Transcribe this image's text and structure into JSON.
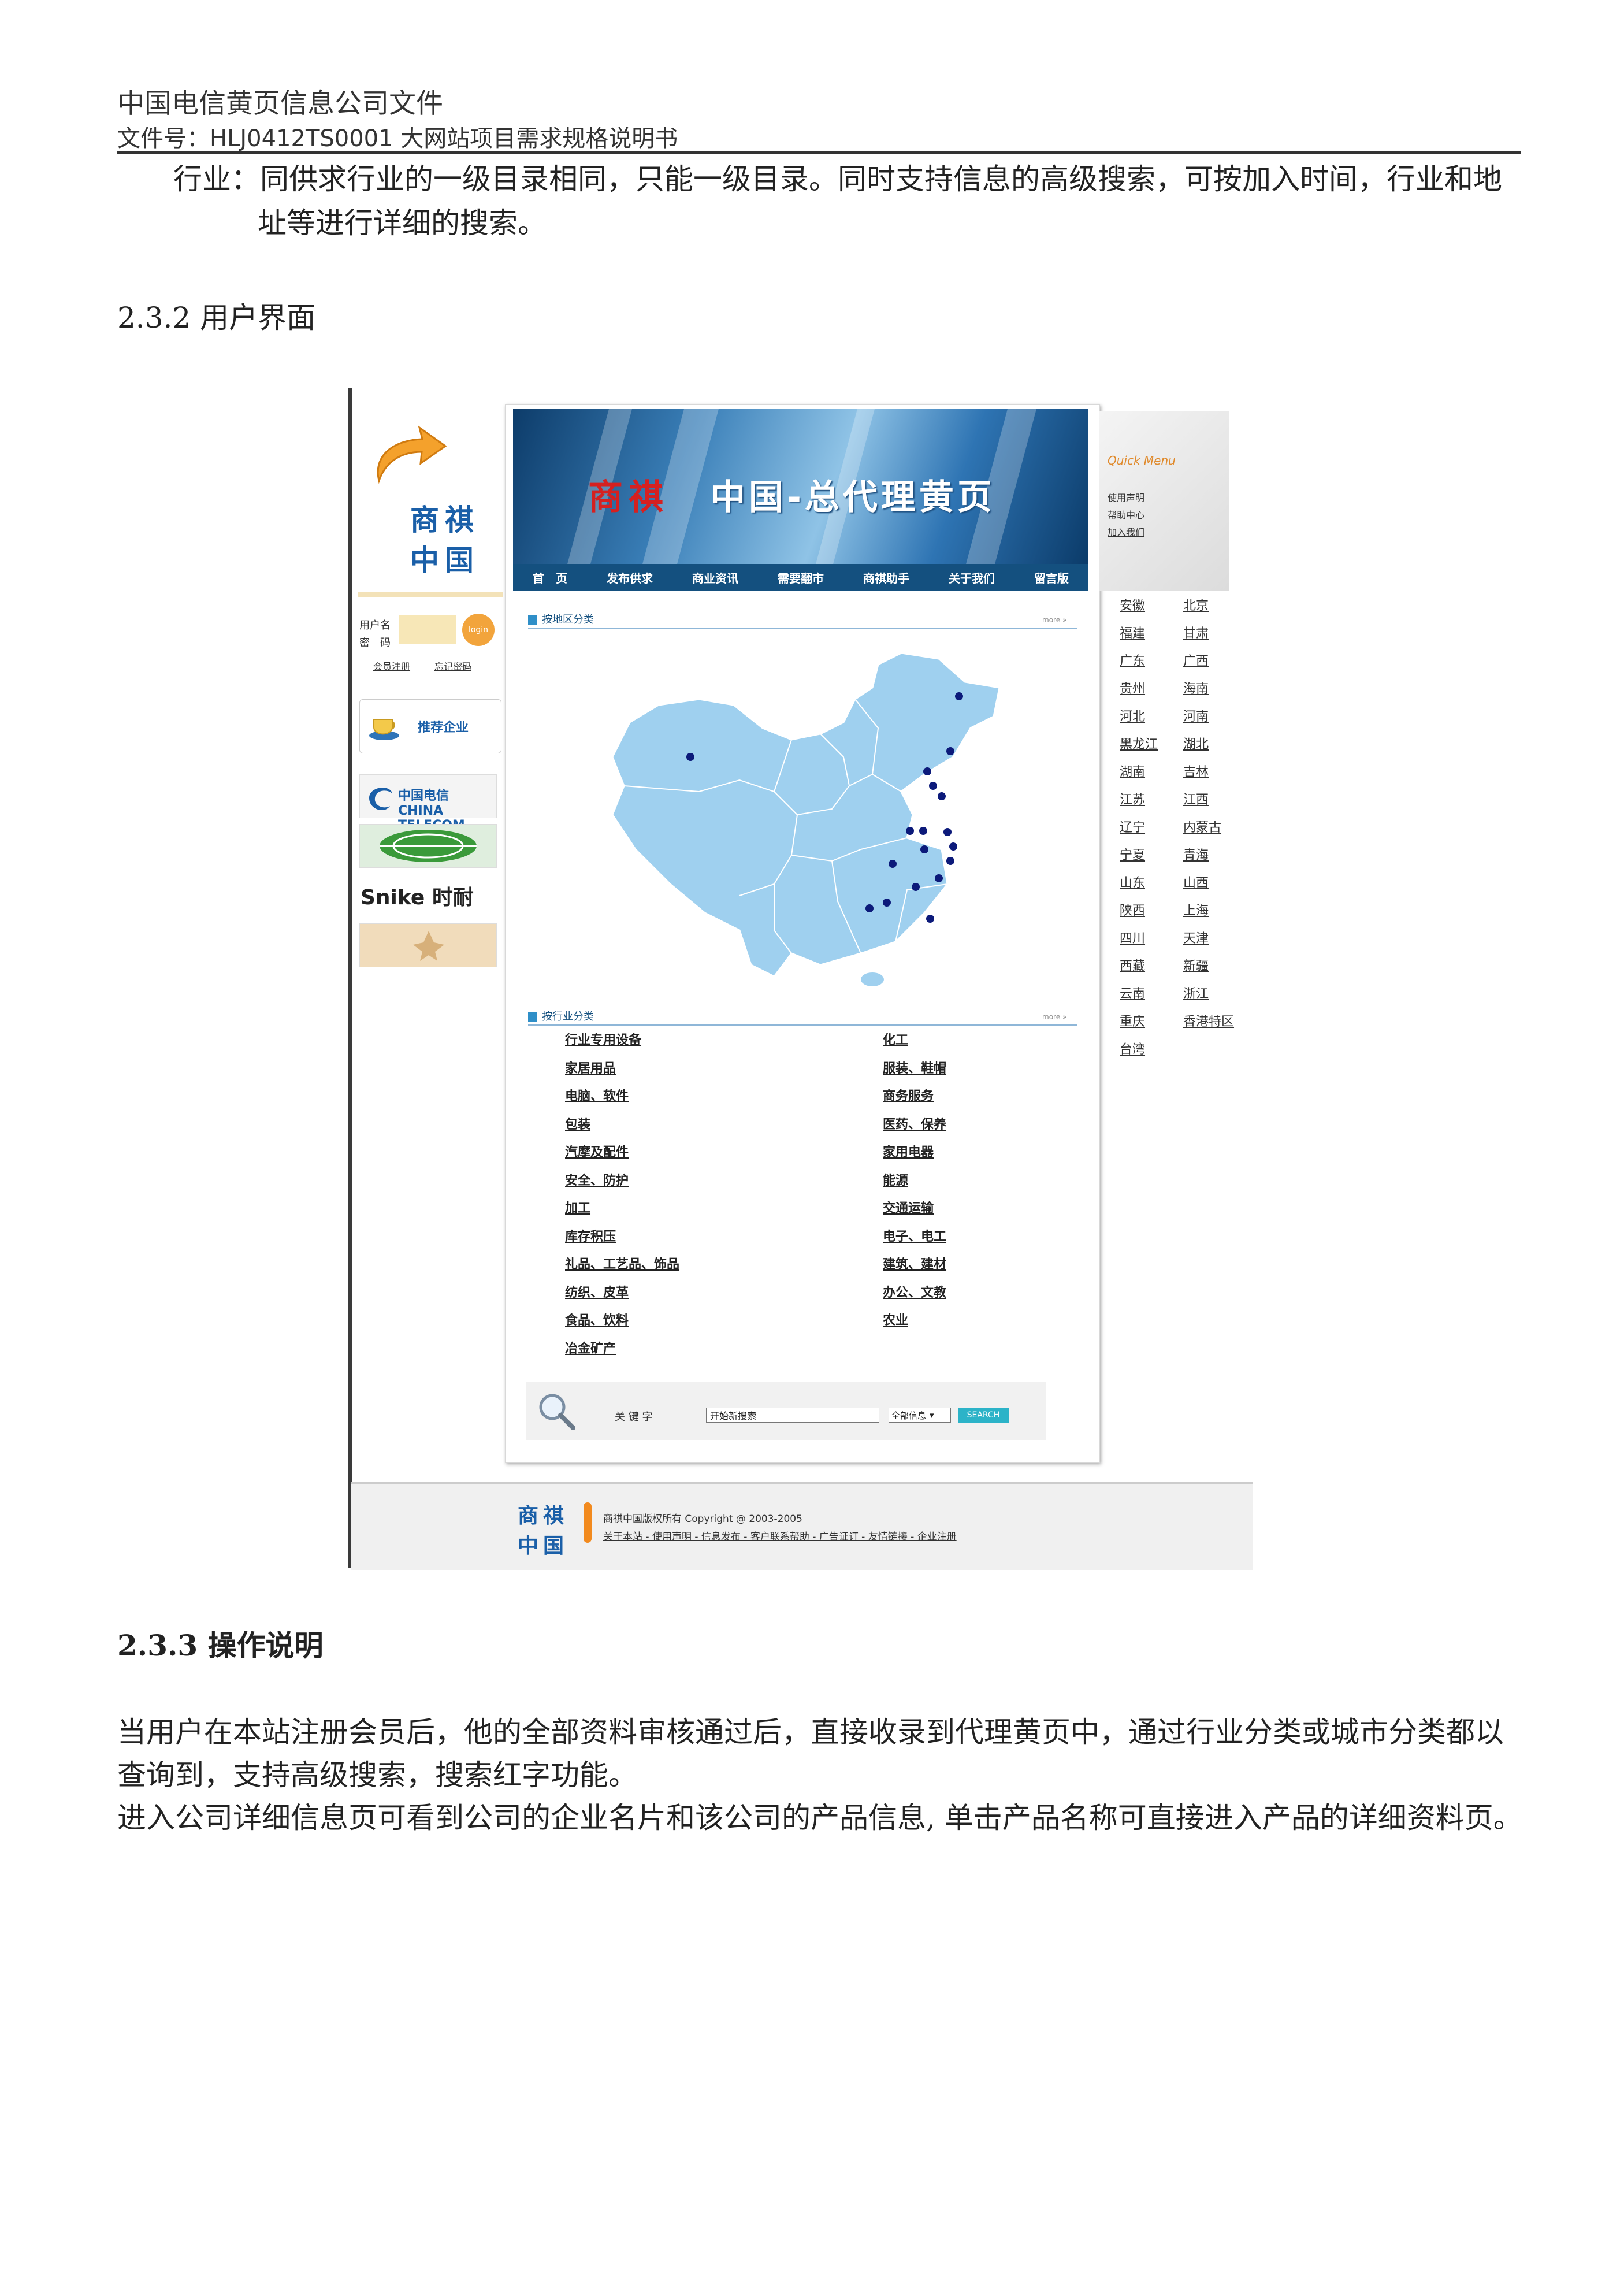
{
  "doc": {
    "header_title": "中国电信黄页信息公司文件",
    "header_docno": "文件号：HLJ0412TS0001  大网站项目需求规格说明书",
    "para1_line1": "行业：同供求行业的一级目录相同，只能一级目录。同时支持信息的高级搜索，可按加入时间，行业和地",
    "para1_line2": "址等进行详细的搜索。",
    "section_232": "2.3.2 用户界面",
    "section_233": "2.3.3 操作说明",
    "para2_line1": "当用户在本站注册会员后，他的全部资料审核通过后，直接收录到代理黄页中，通过行业分类或城市分类都以",
    "para2_line2": "查询到，支持高级搜索，搜索红字功能。",
    "para3_line1": "进入公司详细信息页可看到公司的企业名片和该公司的产品信息, 单击产品名称可直接进入产品的详细资料页。"
  },
  "site": {
    "logo_line1": "商祺",
    "logo_line2": "中国",
    "banner_brand": "商祺",
    "banner_slogan": "中国-总代理黄页",
    "nav": [
      "首　页",
      "发布供求",
      "商业资讯",
      "需要翻市",
      "商祺助手",
      "关于我们",
      "留言版"
    ],
    "quick_menu": {
      "title": "Quick Menu",
      "items": [
        "使用声明",
        "帮助中心",
        "加入我们"
      ]
    },
    "login": {
      "username_label": "用户名",
      "password_label": "密　码",
      "button": "login",
      "register_link": "会员注册",
      "forgot_link": "忘记密码"
    },
    "recommend_label": "推荐企业",
    "partners": [
      "中国电信 CHINA TELECOM",
      "",
      "Snike 时耐",
      ""
    ],
    "region_section_title": "按地区分类",
    "industry_section_title": "按行业分类",
    "more_label": "more »",
    "regions_col1": [
      "安徽",
      "福建",
      "广东",
      "贵州",
      "河北",
      "黑龙江",
      "湖南",
      "江苏",
      "辽宁",
      "宁夏",
      "山东",
      "陕西",
      "四川",
      "西藏",
      "云南",
      "重庆",
      "台湾"
    ],
    "regions_col2": [
      "北京",
      "甘肃",
      "广西",
      "海南",
      "河南",
      "湖北",
      "吉林",
      "江西",
      "内蒙古",
      "青海",
      "山西",
      "上海",
      "天津",
      "新疆",
      "浙江",
      "香港特区"
    ],
    "industries_col1": [
      "行业专用设备",
      "家居用品",
      "电脑、软件",
      "包装",
      "汽摩及配件",
      "安全、防护",
      "加工",
      "库存积压",
      "礼品、工艺品、饰品",
      "纺织、皮革",
      "食品、饮料",
      "冶金矿产"
    ],
    "industries_col2": [
      "化工",
      "服装、鞋帽",
      "商务服务",
      "医药、保养",
      "家用电器",
      "能源",
      "交通运输",
      "电子、电工",
      "建筑、建材",
      "办公、文教",
      "农业"
    ],
    "search": {
      "keyword_label": "关 键 字",
      "input_value": "开始新搜索",
      "select_value": "全部信息",
      "button": "SEARCH"
    },
    "footer": {
      "logo_line1": "商祺",
      "logo_line2": "中国",
      "copyright": "商祺中国版权所有 Copyright @ 2003-2005",
      "links": "关于本站 - 使用声明 - 信息发布 - 客户联系帮助 - 广告证订 - 友情链接 - 企业注册"
    }
  },
  "colors": {
    "nav_bg": "#14507f",
    "brand_blue": "#1a5fa8",
    "brand_red": "#d62020",
    "accent_orange": "#f28a1e",
    "map_fill": "#9fd0ef",
    "map_dot": "#0c1a7a"
  }
}
